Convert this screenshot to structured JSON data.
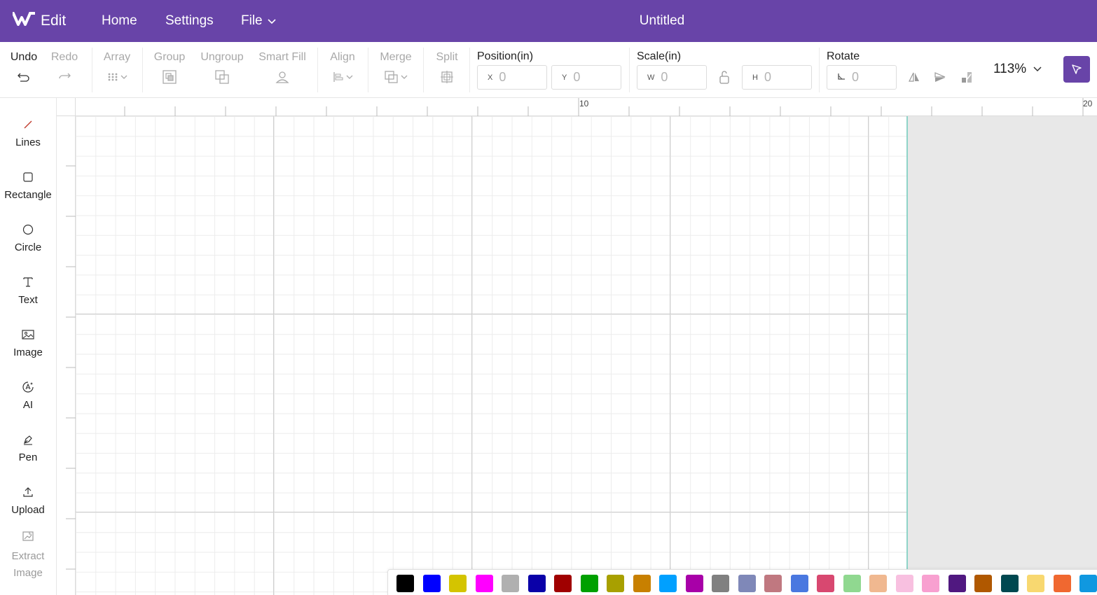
{
  "app": {
    "name": "Edit",
    "document_title": "Untitled"
  },
  "nav": {
    "home": "Home",
    "settings": "Settings",
    "file": "File"
  },
  "toolbar": {
    "undo": "Undo",
    "redo": "Redo",
    "array": "Array",
    "group": "Group",
    "ungroup": "Ungroup",
    "smart_fill": "Smart Fill",
    "align": "Align",
    "merge": "Merge",
    "split": "Split"
  },
  "position": {
    "label": "Position(in)",
    "x_prefix": "X",
    "x_value": "0",
    "y_prefix": "Y",
    "y_value": "0"
  },
  "scale": {
    "label": "Scale(in)",
    "w_prefix": "W",
    "w_value": "0",
    "h_prefix": "H",
    "h_value": "0"
  },
  "rotate": {
    "label": "Rotate",
    "value": "0"
  },
  "zoom": {
    "value": "113%"
  },
  "sidebar": {
    "items": [
      {
        "label": "Lines",
        "icon": "line-icon"
      },
      {
        "label": "Rectangle",
        "icon": "rectangle-icon"
      },
      {
        "label": "Circle",
        "icon": "circle-icon"
      },
      {
        "label": "Text",
        "icon": "text-icon"
      },
      {
        "label": "Image",
        "icon": "image-icon"
      },
      {
        "label": "AI",
        "icon": "ai-icon"
      },
      {
        "label": "Pen",
        "icon": "pen-icon"
      },
      {
        "label": "Upload",
        "icon": "upload-icon"
      },
      {
        "label_line1": "Extract",
        "label_line2": "Image",
        "icon": "extract-image-icon"
      }
    ]
  },
  "ruler": {
    "h_labels": [
      "10",
      "20"
    ]
  },
  "palette": {
    "colors": [
      "#000000",
      "#0000ff",
      "#d4c400",
      "#ff00ff",
      "#b0b0b0",
      "#0a00a8",
      "#a00000",
      "#00a000",
      "#a8a000",
      "#c88000",
      "#00a0ff",
      "#a800a8",
      "#808080",
      "#7f88b8",
      "#c07880",
      "#4a78e0",
      "#d84870",
      "#90d890",
      "#f0b890",
      "#f8c0e0",
      "#f8a0d0",
      "#501880",
      "#b05800",
      "#004850",
      "#f8d870",
      "#f06830",
      "#1098e0"
    ]
  },
  "colors": {
    "brand": "#6844a8",
    "selection_edge": "#8fd4c8"
  }
}
